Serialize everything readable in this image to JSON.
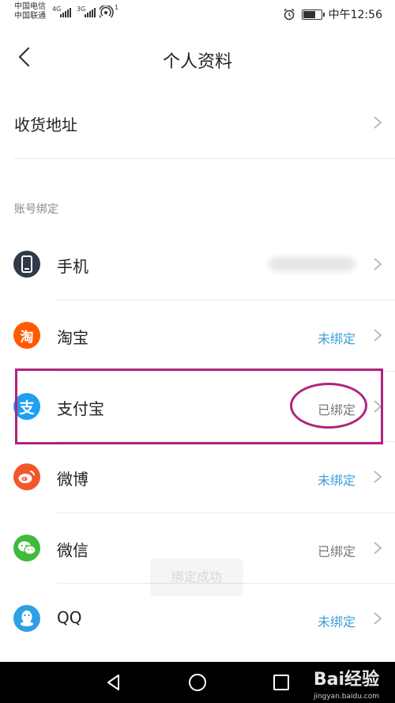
{
  "status_bar": {
    "carrier_1": "中国电信",
    "carrier_2": "中国联通",
    "net_1": "4G",
    "net_2": "3G",
    "hotspot_count": "1",
    "time": "中午12:56",
    "battery_level": 0.7,
    "icons": [
      "signal-icon",
      "wifi-hotspot-icon",
      "alarm-icon",
      "battery-icon"
    ]
  },
  "header": {
    "title": "个人资料",
    "back_icon": "chevron-left-icon"
  },
  "address": {
    "label": "收货地址"
  },
  "account_binding": {
    "section_label": "账号绑定",
    "items": [
      {
        "name": "手机",
        "icon": "phone-icon",
        "icon_color": "#2f3a48",
        "status": "",
        "status_type": "hidden"
      },
      {
        "name": "淘宝",
        "icon": "taobao-icon",
        "icon_color": "#ff5a00",
        "status": "未绑定",
        "status_type": "unbound"
      },
      {
        "name": "支付宝",
        "icon": "alipay-icon",
        "icon_color": "#1e9ff2",
        "status": "已绑定",
        "status_type": "bound"
      },
      {
        "name": "微博",
        "icon": "weibo-icon",
        "icon_color": "#f4562b",
        "status": "未绑定",
        "status_type": "unbound"
      },
      {
        "name": "微信",
        "icon": "wechat-icon",
        "icon_color": "#3fba3b",
        "status": "已绑定",
        "status_type": "bound"
      },
      {
        "name": "QQ",
        "icon": "qq-icon",
        "icon_color": "#2ea1e6",
        "status": "未绑定",
        "status_type": "unbound"
      }
    ]
  },
  "toast": {
    "text": "绑定成功"
  },
  "colors": {
    "unbound": "#3aa0d8",
    "bound": "#777777",
    "annotation": "#b0247e",
    "navbar": "#000000"
  },
  "watermark": {
    "brand": "Bai经验",
    "url": "jingyan.baidu.com"
  }
}
